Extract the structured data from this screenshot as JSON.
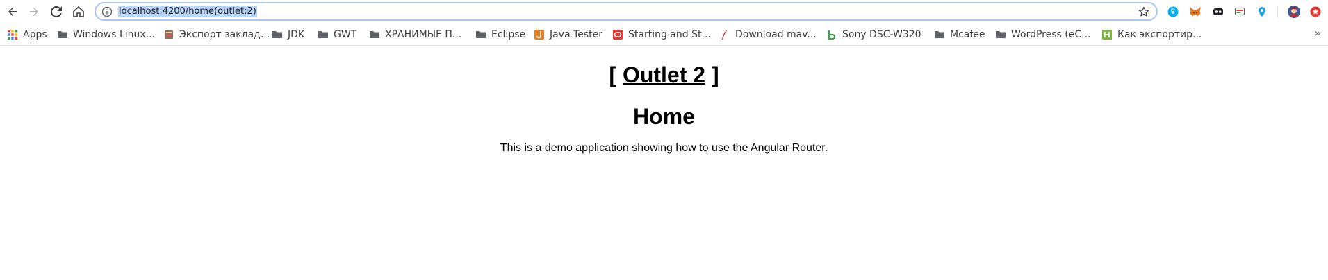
{
  "browser": {
    "address_bar": {
      "url": "localhost:4200/home(outlet:2)"
    },
    "icons": {
      "back": "back-arrow-icon",
      "forward": "forward-arrow-icon",
      "reload": "reload-icon",
      "home": "home-icon",
      "site_info": "info-icon",
      "bookmark_star": "star-icon"
    },
    "extensions": [
      {
        "name": "skype-extension-icon",
        "color": "#00aff0"
      },
      {
        "name": "metamask-extension-icon",
        "color": "#e2761b"
      },
      {
        "name": "mask-extension-icon",
        "color": "#202124"
      },
      {
        "name": "cast-extension-icon",
        "color": "#5f6368"
      },
      {
        "name": "location-extension-icon",
        "color": "#1ca0e3"
      },
      {
        "name": "profile-avatar",
        "color": "#c62828"
      },
      {
        "name": "red-extension-icon",
        "color": "#e53935"
      }
    ],
    "bookmarks": {
      "apps_label": "Apps",
      "items": [
        {
          "label": "Windows Linux...",
          "icon": "folder-icon"
        },
        {
          "label": "Экспорт заклад...",
          "icon": "book-favicon"
        },
        {
          "label": "JDK",
          "icon": "folder-icon"
        },
        {
          "label": "GWT",
          "icon": "folder-icon"
        },
        {
          "label": "ХРАНИМЫЕ П...",
          "icon": "folder-icon"
        },
        {
          "label": "Eclipse",
          "icon": "folder-icon"
        },
        {
          "label": "Java Tester",
          "icon": "java-favicon"
        },
        {
          "label": "Starting and St...",
          "icon": "oracle-favicon"
        },
        {
          "label": "Download mav...",
          "icon": "feather-favicon"
        },
        {
          "label": "Sony DSC-W320",
          "icon": "green-b-favicon"
        },
        {
          "label": "Mcafee",
          "icon": "folder-icon"
        },
        {
          "label": "WordPress (eC...",
          "icon": "folder-icon"
        },
        {
          "label": "Как экспортир...",
          "icon": "green-h-favicon"
        }
      ],
      "overflow": "»"
    }
  },
  "page": {
    "outlet": {
      "open_bracket": "[",
      "link_label": "Outlet 2",
      "close_bracket": "]"
    },
    "title": "Home",
    "description": "This is a demo application showing how to use the Angular Router."
  }
}
